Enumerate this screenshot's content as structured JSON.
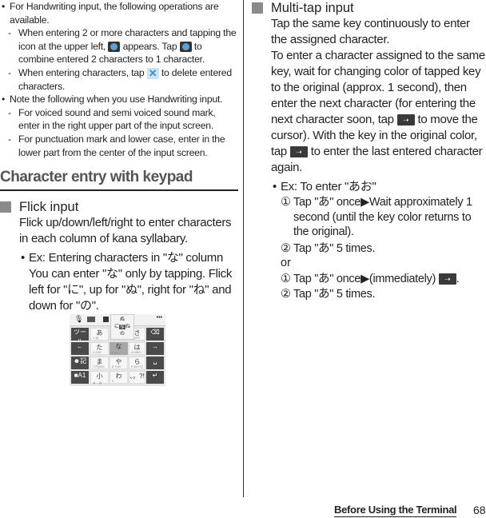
{
  "left": {
    "bullets": [
      {
        "text": "For Handwriting input, the following operations are available.",
        "sub": [
          {
            "parts": [
              "When entering 2 or more characters and tapping the icon at the upper left,",
              "appears. Tap",
              "to combine entered 2 characters to 1 character."
            ],
            "icon": "combine-icon"
          },
          {
            "parts": [
              "When entering characters, tap",
              "to delete entered characters."
            ],
            "icon": "delete-icon"
          }
        ]
      },
      {
        "text": "Note the following when you use Handwriting input.",
        "sub": [
          {
            "text": "For voiced sound and semi voiced sound mark, enter in the right upper part of the input screen."
          },
          {
            "text": "For punctuation mark and lower case, enter in the lower part from the center of the input screen."
          }
        ]
      }
    ],
    "section_heading": "Character entry with keypad",
    "flick": {
      "title": "Flick input",
      "body": "Flick up/down/left/right to enter characters in each column of kana syllabary.",
      "example_title": "Ex: Entering characters in \"な\" column",
      "example_body": "You can enter \"な\" only by tapping. Flick left for \"に\", up for \"ぬ\", right for \"ね\" and down for \"の\"."
    },
    "keypad": {
      "top_icons": [
        "mic-icon",
        "keyboard-icon",
        "grid-icon",
        "more-icon"
      ],
      "more_label": "•••",
      "popup": {
        "center": "な",
        "up": "ぬ",
        "left": "に",
        "right": "ね",
        "down": "の"
      },
      "rows": [
        [
          {
            "label": "ツール",
            "type": "dark"
          },
          {
            "label": "あ",
            "sub": "1 @",
            "type": "light"
          },
          {
            "label": "か",
            "sub": "2 ABC",
            "type": "light"
          },
          {
            "label": "さ",
            "sub": "3 DEF",
            "type": "light"
          },
          {
            "label": "⌫",
            "type": "dark"
          }
        ],
        [
          {
            "label": "←",
            "type": "dark"
          },
          {
            "label": "た",
            "sub": "4 GHI",
            "type": "light"
          },
          {
            "label": "な",
            "sub": "5 JKL",
            "type": "sel"
          },
          {
            "label": "は",
            "sub": "6 MNO",
            "type": "light"
          },
          {
            "label": "→",
            "type": "dark"
          }
        ],
        [
          {
            "label": "☻記",
            "type": "dark"
          },
          {
            "label": "ま",
            "sub": "7 PQRS",
            "type": "light"
          },
          {
            "label": "や",
            "sub": "8 TUV",
            "type": "light"
          },
          {
            "label": "ら",
            "sub": "9 WXYZ",
            "type": "light"
          },
          {
            "label": "␣",
            "type": "dark"
          }
        ],
        [
          {
            "label": "■A1",
            "type": "dark"
          },
          {
            "label": "小 ゛゜",
            "type": "light"
          },
          {
            "label": "わ",
            "sub": "0",
            "type": "light"
          },
          {
            "label": "、。?!",
            "type": "light"
          },
          {
            "label": "↵",
            "type": "dark"
          }
        ]
      ]
    }
  },
  "right": {
    "multitap": {
      "title": "Multi-tap input",
      "p1": "Tap the same key continuously to enter the assigned character.",
      "p2_parts": [
        "To enter a character assigned to the same key, wait for changing color of tapped key to the original (approx. 1 second), then enter the next character (for entering the next character soon, tap",
        "to move the cursor). With the key in the original color, tap",
        "to enter the last entered character again."
      ],
      "example_title": "Ex: To enter \"あお\"",
      "steps_a": [
        {
          "num": "①",
          "text": "Tap \"あ\" once▶Wait approximately 1 second (until the key color returns to the original)."
        },
        {
          "num": "②",
          "text": "Tap \"あ\" 5 times."
        }
      ],
      "or_label": "or",
      "steps_b": [
        {
          "num": "①",
          "text_before": "Tap \"あ\" once▶(immediately)",
          "text_after": "."
        },
        {
          "num": "②",
          "text": "Tap \"あ\" 5 times."
        }
      ]
    }
  },
  "footer": {
    "section": "Before Using the Terminal",
    "page": "68"
  },
  "icons": {
    "arrow_glyph": "➝"
  }
}
